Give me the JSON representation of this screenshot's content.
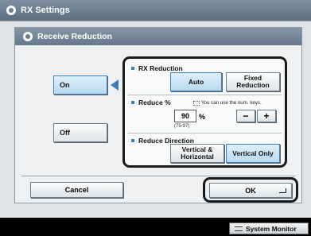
{
  "app": {
    "title": "RX Settings"
  },
  "dialog": {
    "title": "Receive Reduction"
  },
  "mode": {
    "on_label": "On",
    "off_label": "Off",
    "selected": "On"
  },
  "rx_reduction": {
    "label": "RX Reduction",
    "options": [
      "Auto",
      "Fixed Reduction"
    ],
    "selected": "Auto"
  },
  "reduce_percent": {
    "label": "Reduce %",
    "hint": "You can use the num. keys.",
    "value": "90",
    "unit": "%",
    "range": "(75-97)",
    "minus_label": "−",
    "plus_label": "+"
  },
  "reduce_direction": {
    "label": "Reduce Direction",
    "options": [
      "Vertical & Horizontal",
      "Vertical Only"
    ],
    "selected": "Vertical Only"
  },
  "buttons": {
    "cancel": "Cancel",
    "ok": "OK"
  },
  "status_bar": {
    "system_monitor": "System Monitor"
  },
  "colors": {
    "accent": "#3c7fb8",
    "titlebar": "#6a7c8c",
    "selected_fill": "#c7e3f4"
  }
}
